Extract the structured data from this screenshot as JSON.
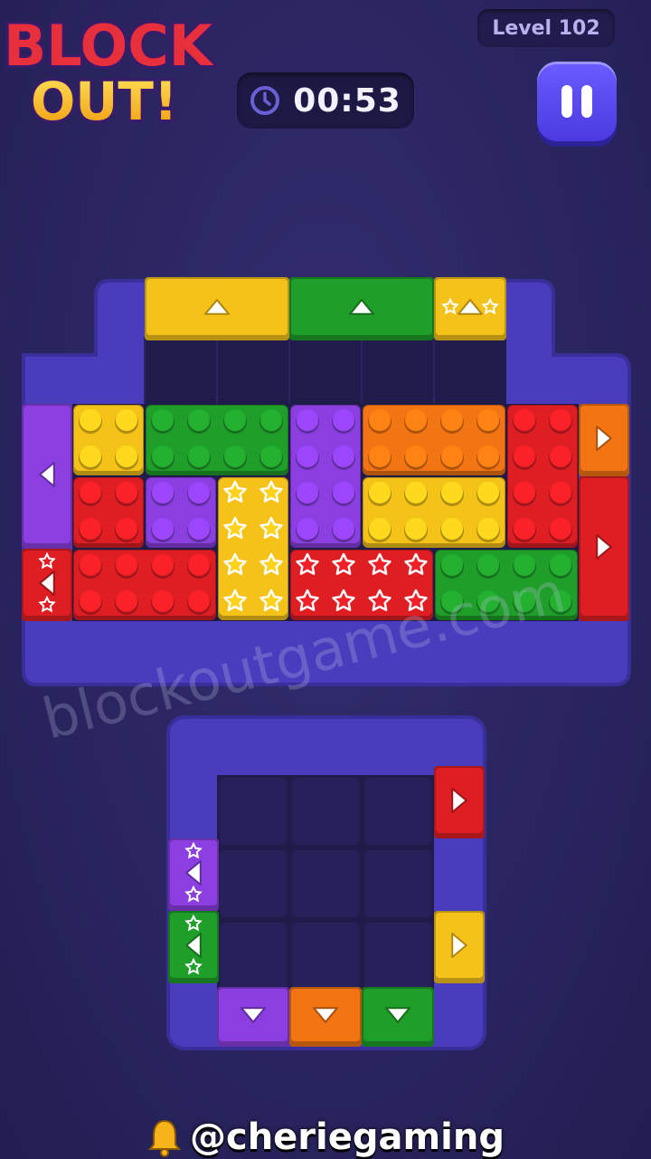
{
  "game": {
    "logo_text_line1": "BLOCK",
    "logo_text_line2": "OUT!",
    "level_label": "Level 102",
    "timer": "00:53"
  },
  "watermark": "blockoutgame.com",
  "credit": "@cheriegaming",
  "icons": {
    "timer": "clock-icon",
    "pause": "pause-icon",
    "credit": "bell-icon"
  },
  "colors": {
    "background": "#2a2560",
    "board_frame": "#4a3dbd",
    "yellow": "#f5c21a",
    "green": "#1f9e2a",
    "purple": "#8b3fe0",
    "orange": "#f27412",
    "red": "#df1e24"
  },
  "upper_board": {
    "rows": 3,
    "cols": 7,
    "blocks": [
      {
        "color": "yellow",
        "studs": "dots",
        "row": 0,
        "col": 0,
        "w": 1,
        "h": 1
      },
      {
        "color": "green",
        "studs": "dots",
        "row": 0,
        "col": 1,
        "w": 2,
        "h": 1
      },
      {
        "color": "purple",
        "studs": "dots",
        "row": 0,
        "col": 3,
        "w": 1,
        "h": 2
      },
      {
        "color": "orange",
        "studs": "dots",
        "row": 0,
        "col": 4,
        "w": 2,
        "h": 1
      },
      {
        "color": "red",
        "studs": "dots",
        "row": 0,
        "col": 6,
        "w": 1,
        "h": 2
      },
      {
        "color": "red",
        "studs": "dots",
        "row": 1,
        "col": 0,
        "w": 1,
        "h": 1
      },
      {
        "color": "purple",
        "studs": "dots",
        "row": 1,
        "col": 1,
        "w": 1,
        "h": 1
      },
      {
        "color": "yellow",
        "studs": "stars",
        "row": 1,
        "col": 2,
        "w": 1,
        "h": 2
      },
      {
        "color": "yellow",
        "studs": "dots",
        "row": 1,
        "col": 4,
        "w": 2,
        "h": 1
      },
      {
        "color": "red",
        "studs": "dots",
        "row": 2,
        "col": 0,
        "w": 2,
        "h": 1
      },
      {
        "color": "red",
        "studs": "stars",
        "row": 2,
        "col": 3,
        "w": 2,
        "h": 1
      },
      {
        "color": "green",
        "studs": "dots",
        "row": 2,
        "col": 5,
        "w": 2,
        "h": 1
      }
    ],
    "exits": [
      {
        "side": "top",
        "color": "yellow",
        "arrow": "up",
        "star": false
      },
      {
        "side": "top",
        "color": "green",
        "arrow": "up",
        "star": false
      },
      {
        "side": "top",
        "color": "yellow",
        "arrow": "up",
        "star": true
      },
      {
        "side": "left",
        "color": "purple",
        "arrow": "left",
        "star": false
      },
      {
        "side": "left",
        "color": "red",
        "arrow": "left",
        "star": true
      },
      {
        "side": "right",
        "color": "orange",
        "arrow": "right",
        "star": false
      },
      {
        "side": "right",
        "color": "red",
        "arrow": "right",
        "star": false
      }
    ]
  },
  "lower_board": {
    "rows": 3,
    "cols": 3,
    "exits": [
      {
        "side": "right",
        "color": "red",
        "arrow": "right",
        "star": false
      },
      {
        "side": "right",
        "color": "yellow",
        "arrow": "right",
        "star": false
      },
      {
        "side": "left",
        "color": "purple",
        "arrow": "left",
        "star": true
      },
      {
        "side": "left",
        "color": "green",
        "arrow": "left",
        "star": true
      },
      {
        "side": "bottom",
        "color": "purple",
        "arrow": "down",
        "star": false
      },
      {
        "side": "bottom",
        "color": "orange",
        "arrow": "down",
        "star": false
      },
      {
        "side": "bottom",
        "color": "green",
        "arrow": "down",
        "star": false
      }
    ]
  }
}
